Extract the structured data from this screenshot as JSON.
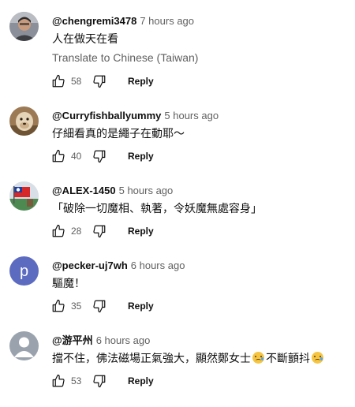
{
  "comments": [
    {
      "author": "@chengremi3478",
      "time": "7 hours ago",
      "text": "人在做天在看",
      "translate": "Translate to Chinese (Taiwan)",
      "likes": "58",
      "reply": "Reply",
      "avatar": "photo-avatar"
    },
    {
      "author": "@Curryfishballyummy",
      "time": "5 hours ago",
      "text": "仔細看真的是繩子在動耶～",
      "likes": "40",
      "reply": "Reply",
      "avatar": "animal-photo-avatar"
    },
    {
      "author": "@ALEX-1450",
      "time": "5 hours ago",
      "text": "「破除一切魔相、執著，令妖魔無處容身」",
      "likes": "28",
      "reply": "Reply",
      "avatar": "flag-photo-avatar"
    },
    {
      "author": "@pecker-uj7wh",
      "time": "6 hours ago",
      "text": "驅魔！",
      "likes": "35",
      "reply": "Reply",
      "avatar": "letter-avatar",
      "avatar_letter": "p",
      "avatar_color": "#5c6bc0"
    },
    {
      "author": "@游平州",
      "time": "6 hours ago",
      "text_before": "擋不住，佛法磁場正氣強大，顯然鄭女士",
      "text_middle": "不斷顫抖",
      "likes": "53",
      "reply": "Reply",
      "avatar": "default-person-avatar"
    }
  ],
  "icons": {
    "like": "thumb-up-icon",
    "dislike": "thumb-down-icon",
    "emoji": "crying-face-emoji"
  }
}
